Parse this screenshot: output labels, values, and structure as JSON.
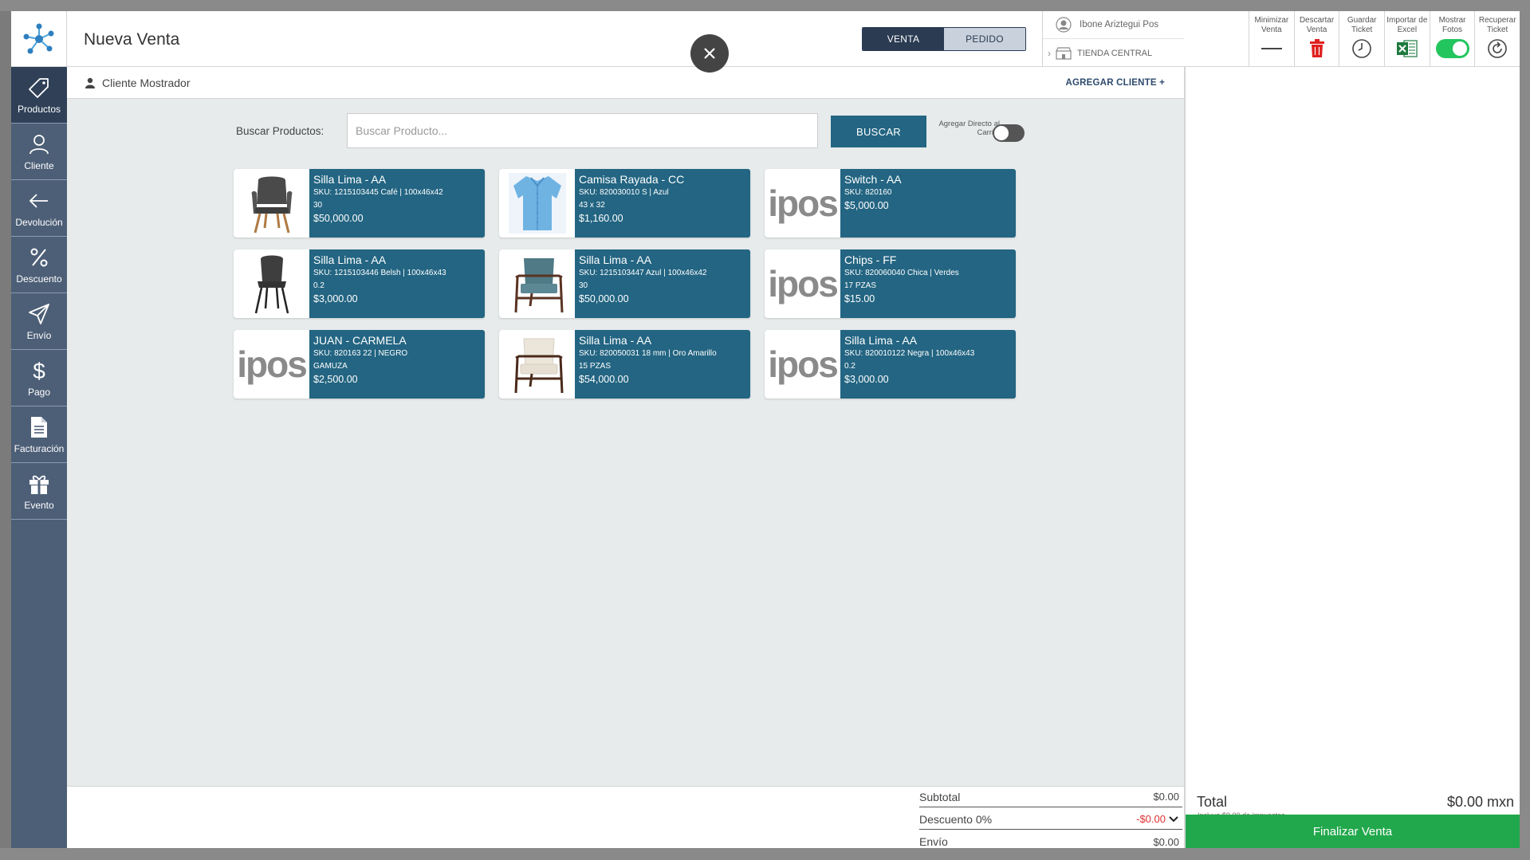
{
  "header": {
    "title": "Nueva Venta",
    "mode_sale": "VENTA",
    "mode_order": "PEDIDO",
    "user_name": "Ibone Ariztegui Pos",
    "store_name": "TIENDA CENTRAL"
  },
  "sidebar": {
    "items": [
      {
        "label": "Productos",
        "icon": "tag-icon"
      },
      {
        "label": "Cliente",
        "icon": "user-icon"
      },
      {
        "label": "Devolución",
        "icon": "arrow-left-icon"
      },
      {
        "label": "Descuento",
        "icon": "percent-icon"
      },
      {
        "label": "Envío",
        "icon": "send-icon"
      },
      {
        "label": "Pago",
        "icon": "dollar-icon"
      },
      {
        "label": "Facturación",
        "icon": "document-icon"
      },
      {
        "label": "Evento",
        "icon": "gift-icon"
      }
    ]
  },
  "tools": [
    {
      "label": "Minimizar Venta",
      "icon": "minus-icon"
    },
    {
      "label": "Descartar Venta",
      "icon": "trash-icon",
      "color": "#e02020"
    },
    {
      "label": "Guardar Ticket",
      "icon": "clock-icon"
    },
    {
      "label": "Importar de Excel",
      "icon": "excel-icon",
      "color": "#1d7a3e"
    },
    {
      "label": "Mostrar Fotos",
      "icon": "toggle-on-icon",
      "color": "#22c55e"
    },
    {
      "label": "Recuperar Ticket",
      "icon": "refresh-icon"
    }
  ],
  "client": {
    "name": "Cliente Mostrador",
    "add_label": "AGREGAR CLIENTE +"
  },
  "search": {
    "label": "Buscar Productos:",
    "placeholder": "Buscar Producto...",
    "button": "BUSCAR",
    "direct_label": "Agregar Directo al Carrito"
  },
  "products": [
    {
      "name": "Silla Lima - AA",
      "line1": "SKU: 1215103445 Café | 100x46x42",
      "line2": "30",
      "price": "$50,000.00",
      "image": "armchair-grey"
    },
    {
      "name": "Camisa Rayada - CC",
      "line1": "SKU: 820030010 S | Azul",
      "line2": "43 x 32",
      "price": "$1,160.00",
      "image": "shirt-blue"
    },
    {
      "name": "Switch - AA",
      "line1": "SKU: 820160",
      "line2": "",
      "price": "$5,000.00",
      "image": "ipos-logo"
    },
    {
      "name": "Silla Lima - AA",
      "line1": "SKU: 1215103446 Belsh | 100x46x43",
      "line2": "0.2",
      "price": "$3,000.00",
      "image": "chair-dark"
    },
    {
      "name": "Silla Lima - AA",
      "line1": "SKU: 1215103447 Azul | 100x46x42",
      "line2": "30",
      "price": "$50,000.00",
      "image": "armchair-teal"
    },
    {
      "name": "Chips - FF",
      "line1": "SKU: 820060040 Chica | Verdes",
      "line2": "17 PZAS",
      "price": "$15.00",
      "image": "ipos-logo"
    },
    {
      "name": "JUAN - CARMELA",
      "line1": "SKU: 820163 22 | NEGRO",
      "line2": "GAMUZA",
      "price": "$2,500.00",
      "image": "ipos-logo"
    },
    {
      "name": "Silla Lima - AA",
      "line1": "SKU: 820050031 18 mm | Oro Amarillo",
      "line2": "15 PZAS",
      "price": "$54,000.00",
      "image": "armchair-cream"
    },
    {
      "name": "Silla Lima - AA",
      "line1": "SKU: 820010122 Negra | 100x46x43",
      "line2": "0.2",
      "price": "$3,000.00",
      "image": "ipos-logo"
    }
  ],
  "ipos_logo_text": "ipos",
  "summary": {
    "subtotal_label": "Subtotal",
    "subtotal_value": "$0.00",
    "discount_label": "Descuento 0%",
    "discount_value": "-$0.00",
    "shipping_label": "Envío",
    "shipping_value": "$0.00"
  },
  "total": {
    "label": "Total",
    "value": "$0.00 mxn",
    "taxes_note": "Incluye $0.00 de impuestos",
    "finalize_label": "Finalizar Venta"
  },
  "colors": {
    "sidebar": "#4d5f77",
    "card": "#236582",
    "finalize": "#22a84c"
  }
}
